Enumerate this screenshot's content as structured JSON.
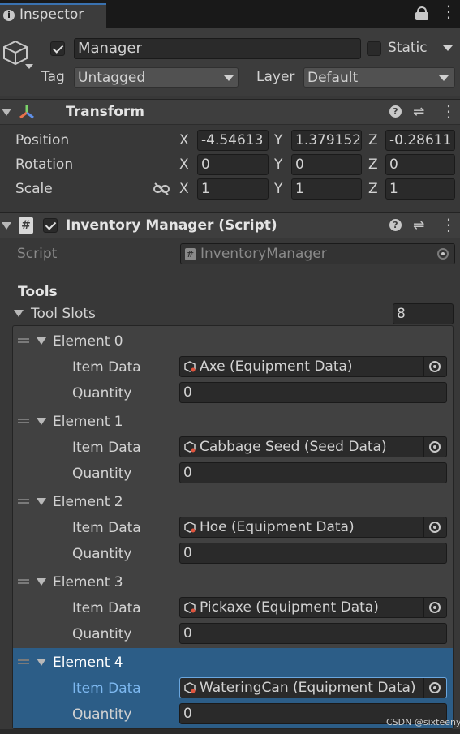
{
  "inspector": {
    "tab_title": "Inspector"
  },
  "object": {
    "active": true,
    "name": "Manager",
    "static_label": "Static",
    "tag_label": "Tag",
    "tag_value": "Untagged",
    "layer_label": "Layer",
    "layer_value": "Default"
  },
  "transform": {
    "title": "Transform",
    "position": {
      "label": "Position",
      "x": "-4.54613",
      "y": "1.379152",
      "z": "-0.28611"
    },
    "rotation": {
      "label": "Rotation",
      "x": "0",
      "y": "0",
      "z": "0"
    },
    "scale": {
      "label": "Scale",
      "x": "1",
      "y": "1",
      "z": "1"
    },
    "axis": {
      "x": "X",
      "y": "Y",
      "z": "Z"
    }
  },
  "script_component": {
    "title": "Inventory Manager (Script)",
    "enabled": true,
    "script_label": "Script",
    "script_value": "InventoryManager",
    "section_header": "Tools",
    "array_label": "Tool Slots",
    "array_size": "8",
    "item_data_label": "Item Data",
    "quantity_label": "Quantity",
    "elements": [
      {
        "label": "Element 0",
        "item": "Axe (Equipment Data)",
        "quantity": "0"
      },
      {
        "label": "Element 1",
        "item": "Cabbage Seed (Seed Data)",
        "quantity": "0"
      },
      {
        "label": "Element 2",
        "item": "Hoe (Equipment Data)",
        "quantity": "0"
      },
      {
        "label": "Element 3",
        "item": "Pickaxe (Equipment Data)",
        "quantity": "0"
      },
      {
        "label": "Element 4",
        "item": "WateringCan (Equipment Data)",
        "quantity": "0"
      }
    ]
  },
  "watermark": "CSDN @sixteenyy",
  "colors": {
    "selection": "#2c5d87",
    "accent_blue": "#3a72b0",
    "link_blue": "#7db8f0"
  }
}
